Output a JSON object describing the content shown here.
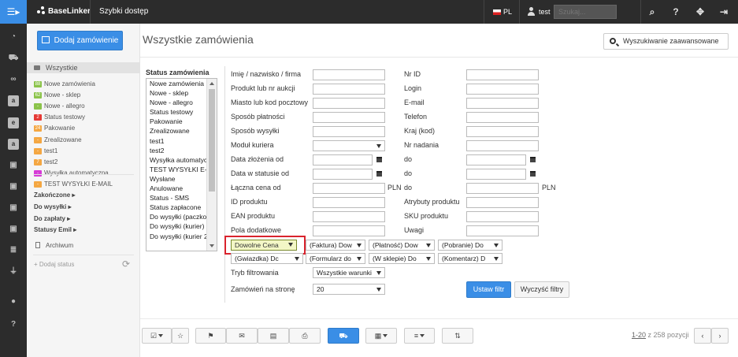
{
  "topbar": {
    "menu_icon": "menu-icon",
    "brand": "BaseLinker",
    "quick_access": "Szybki dostęp",
    "lang": "PL",
    "user": "test",
    "search_placeholder": "Szukaj...",
    "icons": [
      "search-icon",
      "help-icon",
      "move-icon",
      "logout-icon"
    ]
  },
  "rail_icons": [
    "dashboard-icon",
    "cart-icon",
    "link-icon",
    "a-icon",
    "e-icon",
    "a-icon",
    "bag-icon",
    "bag-icon",
    "bag-icon",
    "bag-icon",
    "database-icon",
    "plug-icon",
    "user-icon",
    "help-icon"
  ],
  "sidebar": {
    "add_order": "Dodaj zamówienie",
    "all": "Wszystkie",
    "statuses": [
      {
        "badge": "88",
        "color": "#8bc34a",
        "label": "Nowe zamówienia"
      },
      {
        "badge": "62",
        "color": "#8bc34a",
        "label": "Nowe - sklep"
      },
      {
        "badge": "-",
        "color": "#8bc34a",
        "label": "Nowe - allegro"
      },
      {
        "badge": "2",
        "color": "#e53935",
        "label": "Status testowy"
      },
      {
        "badge": "24",
        "color": "#f4a742",
        "label": "Pakowanie"
      },
      {
        "badge": "-",
        "color": "#f4a742",
        "label": "Zrealizowane"
      },
      {
        "badge": "-",
        "color": "#f4a742",
        "label": "test1"
      },
      {
        "badge": "7",
        "color": "#f4a742",
        "label": "test2"
      },
      {
        "badge": "-",
        "color": "#d63ad6",
        "label": "Wysyłka automatyczna"
      },
      {
        "badge": "-",
        "color": "#f4a742",
        "label": "TEST WYSYŁKI E-MAIL"
      }
    ],
    "groups": [
      "Zakończone",
      "Do wysyłki",
      "Do zapłaty",
      "Statusy Emil"
    ],
    "archive": "Archiwum",
    "add_status": "+ Dodaj status"
  },
  "main": {
    "title": "Wszystkie zamówienia",
    "advanced_search": "Wyszukiwanie zaawansowane",
    "status_title": "Status zamówienia",
    "status_options": [
      "Nowe zamówienia",
      "Nowe - sklep",
      "Nowe - allegro",
      "Status testowy",
      "Pakowanie",
      "Zrealizowane",
      "test1",
      "test2",
      "Wysyłka automatyczna",
      "TEST WYSYŁKI E-MAIL",
      "Wysłane",
      "Anulowane",
      "Status - SMS",
      "Status zapłacone",
      "Do wysyłki (paczkomaty)",
      "Do wysyłki (kurier)",
      "Do wysyłki (kurier 2)"
    ],
    "left_labels": [
      "Imię / nazwisko / firma",
      "Produkt lub nr aukcji",
      "Miasto lub kod pocztowy",
      "Sposób płatności",
      "Sposób wysyłki",
      "Moduł kuriera",
      "Data złożenia od",
      "Data w statusie od",
      "Łączna cena od",
      "ID produktu",
      "EAN produktu",
      "Pola dodatkowe"
    ],
    "right_labels": [
      "Nr ID",
      "Login",
      "E-mail",
      "Telefon",
      "Kraj (kod)",
      "Nr nadania",
      "do",
      "do",
      "do",
      "Atrybuty produktu",
      "SKU produktu",
      "Uwagi"
    ],
    "currency": "PLN",
    "extra_selects_row1": [
      "Dowolne Cena",
      "(Faktura) Dow",
      "(Płatność) Dow",
      "(Pobranie) Do"
    ],
    "extra_selects_row2": [
      "(Gwiazdka) Dc",
      "(Formularz do",
      "(W sklepie) Do",
      "(Komentarz) D"
    ],
    "filter_mode_label": "Tryb filtrowania",
    "filter_mode_value": "Wszystkie warunki",
    "per_page_label": "Zamówień na stronę",
    "per_page_value": "20",
    "btn_set": "Ustaw filtr",
    "btn_clear": "Wyczyść filtry"
  },
  "toolbar": {
    "pagination_range": "1-20",
    "pagination_rest": " z 258 pozycji"
  }
}
